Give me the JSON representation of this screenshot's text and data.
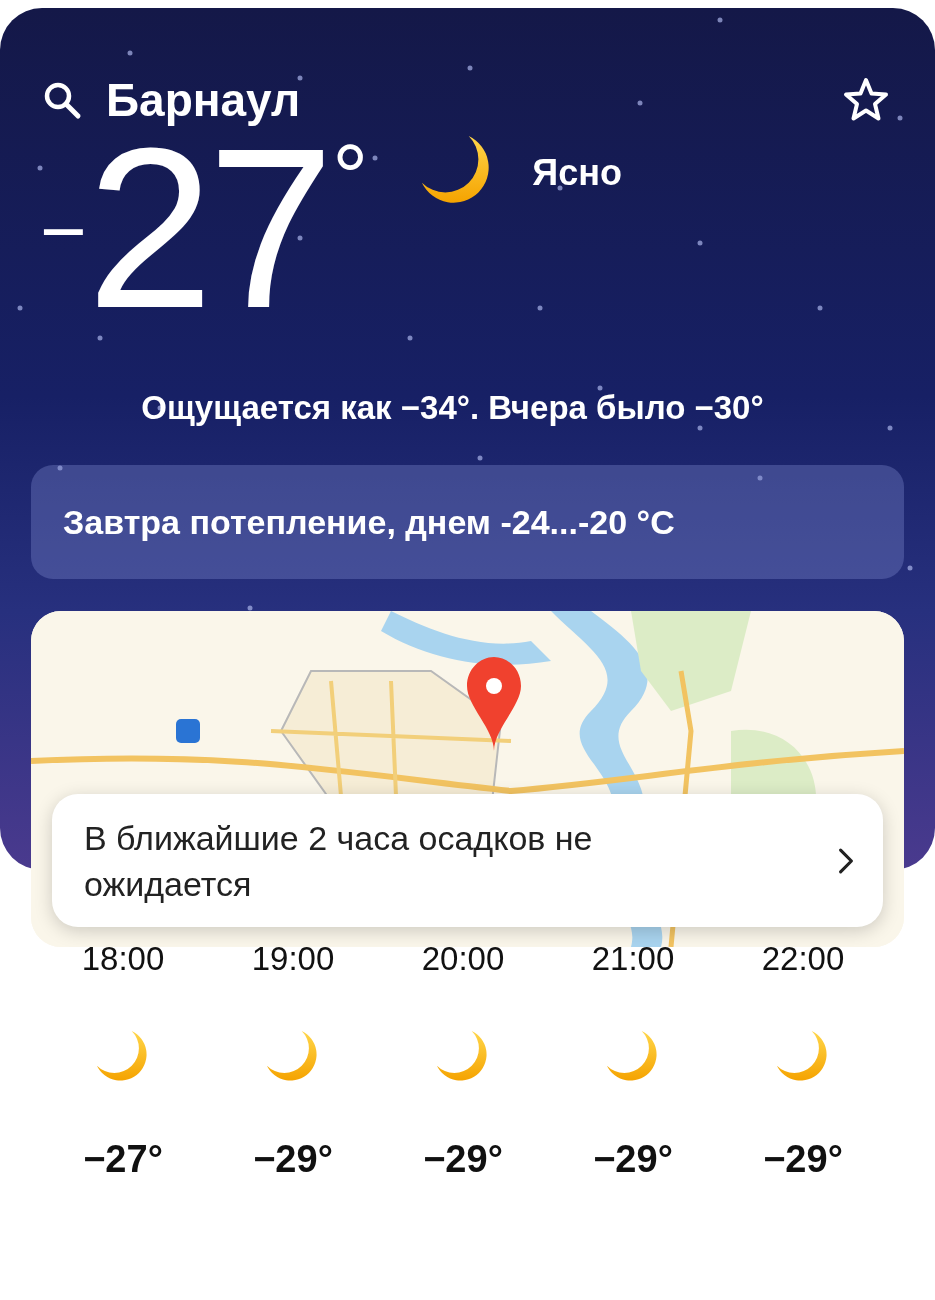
{
  "header": {
    "city": "Барнаул"
  },
  "current": {
    "sign": "−",
    "value": "27",
    "unit": "°",
    "condition": "Ясно",
    "feels_like": "Ощущается как −34°. Вчера было −30°"
  },
  "alert": "Завтра потепление, днем -24...-20 °C",
  "map": {
    "nowcast": "В ближайшие 2 часа осадков не ожидается"
  },
  "hourly": [
    {
      "time": "18:00",
      "temp": "−27°"
    },
    {
      "time": "19:00",
      "temp": "−29°"
    },
    {
      "time": "20:00",
      "temp": "−29°"
    },
    {
      "time": "21:00",
      "temp": "−29°"
    },
    {
      "time": "22:00",
      "temp": "−29°"
    }
  ]
}
